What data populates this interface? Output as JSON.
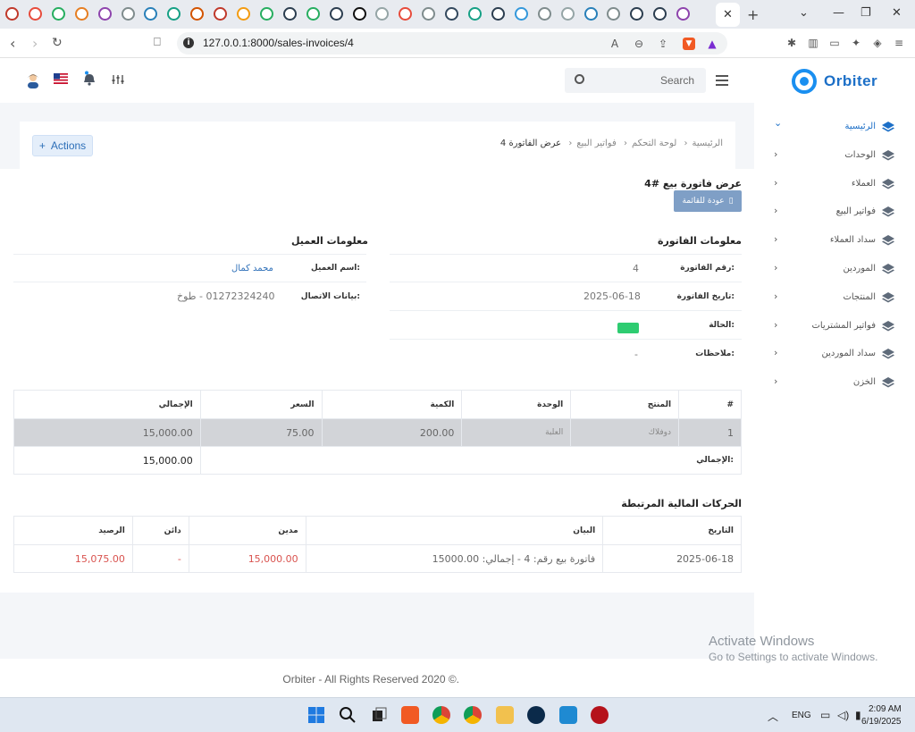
{
  "browser": {
    "url": "127.0.0.1:8000/sales-invoices/4",
    "tab_close": "✕",
    "new_tab": "+"
  },
  "header": {
    "brand": "Orbiter",
    "search_placeholder": "Search"
  },
  "sidebar": {
    "items": [
      {
        "label": "الرئيسية",
        "active": true
      },
      {
        "label": "الوحدات"
      },
      {
        "label": "العملاء"
      },
      {
        "label": "فواتير البيع"
      },
      {
        "label": "سداد العملاء"
      },
      {
        "label": "الموردين"
      },
      {
        "label": "المنتجات"
      },
      {
        "label": "فواتير المشتريات"
      },
      {
        "label": "سداد الموردين"
      },
      {
        "label": "الخزن"
      }
    ]
  },
  "topbar": {
    "actions_label": "Actions",
    "breadcrumb": [
      "الرئيسية",
      "لوحة التحكم",
      "فواتير البيع",
      "عرض الفاتورة 4"
    ]
  },
  "invoice": {
    "title": "عرض فاتورة بيع #4",
    "back_label": "عودة للقائمة",
    "info_title": "معلومات الفاتورة",
    "customer_title": "معلومات العميل",
    "fields": {
      "number_label": "رقم الفاتورة:",
      "number": "4",
      "date_label": "تاريخ الفاتورة:",
      "date": "2025-06-18",
      "status_label": "الحالة:",
      "notes_label": "ملاحظات:",
      "notes": "-"
    },
    "customer": {
      "name_label": "اسم العميل:",
      "name": "محمد كمال",
      "contact_label": "بيانات الاتصال:",
      "contact": "01272324240 - طوخ"
    }
  },
  "items_table": {
    "headers": [
      "#",
      "المنتج",
      "الوحدة",
      "الكمية",
      "السعر",
      "الإجمالي"
    ],
    "rows": [
      [
        "1",
        "دوفلاك",
        "العلبة",
        "200.00",
        "75.00",
        "15,000.00"
      ]
    ],
    "total_label": "الإجمالي:",
    "total_value": "15,000.00"
  },
  "transactions": {
    "title": "الحركات المالية المرتبطة",
    "headers": [
      "التاريخ",
      "البيان",
      "مدين",
      "دائن",
      "الرصيد"
    ],
    "rows": [
      [
        "2025-06-18",
        "فاتورة بيع رقم: 4 - إجمالي: 15000.00",
        "15,000.00",
        "-",
        "15,075.00"
      ]
    ]
  },
  "footer": {
    "text": "Orbiter - All Rights Reserved 2020 ©."
  },
  "watermark": {
    "line1": "Activate Windows",
    "line2": "Go to Settings to activate Windows."
  },
  "taskbar": {
    "lang": "ENG",
    "time": "2:09 AM",
    "date": "6/19/2025"
  },
  "colors": {
    "brand": "#1c6fc7",
    "status": "#2ecc71",
    "debit": "#d9534f"
  }
}
